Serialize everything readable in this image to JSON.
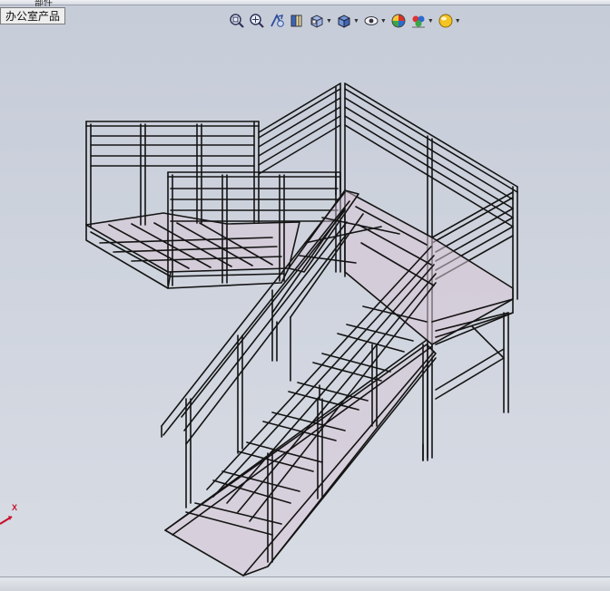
{
  "window": {
    "tab_label_clipped": "部件",
    "tab_label": "办公室产品"
  },
  "toolbar": {
    "tools": [
      {
        "icon": "zoom-to-fit-icon",
        "dropdown": false
      },
      {
        "icon": "zoom-to-area-icon",
        "dropdown": false
      },
      {
        "icon": "previous-view-icon",
        "dropdown": false
      },
      {
        "icon": "section-view-icon",
        "dropdown": false
      },
      {
        "icon": "view-orientation-icon",
        "dropdown": true
      },
      {
        "icon": "display-style-icon",
        "dropdown": true
      },
      {
        "icon": "hide-show-items-icon",
        "dropdown": true
      },
      {
        "icon": "edit-appearance-icon",
        "dropdown": false
      },
      {
        "icon": "apply-scene-icon",
        "dropdown": true
      },
      {
        "icon": "view-settings-icon",
        "dropdown": true
      }
    ]
  },
  "triad": {
    "axis_label": "X",
    "axis_color": "#c8102e"
  },
  "colors": {
    "viewport_bg": "#cdd2dc",
    "frame_edge": "#141414",
    "tread_fill": "#d8c6d6"
  }
}
